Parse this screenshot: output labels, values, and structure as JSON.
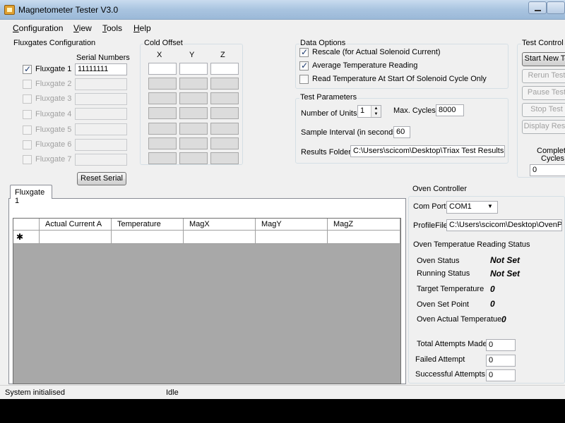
{
  "window": {
    "title": "Magnetometer Tester V3.0"
  },
  "menu": [
    "Configuration",
    "View",
    "Tools",
    "Help"
  ],
  "fluxgates": {
    "group_label": "Fluxgates Configuration",
    "serial_header": "Serial Numbers",
    "rows": [
      {
        "label": "Fluxgate 1",
        "checked": true,
        "enabled": true,
        "serial": "11111111"
      },
      {
        "label": "Fluxgate 2",
        "checked": false,
        "enabled": false,
        "serial": ""
      },
      {
        "label": "Fluxgate 3",
        "checked": false,
        "enabled": false,
        "serial": ""
      },
      {
        "label": "Fluxgate 4",
        "checked": false,
        "enabled": false,
        "serial": ""
      },
      {
        "label": "Fluxgate 5",
        "checked": false,
        "enabled": false,
        "serial": ""
      },
      {
        "label": "Fluxgate 6",
        "checked": false,
        "enabled": false,
        "serial": ""
      },
      {
        "label": "Fluxgate 7",
        "checked": false,
        "enabled": false,
        "serial": ""
      }
    ],
    "reset_button": "Reset Serial"
  },
  "cold_offset": {
    "group_label": "Cold Offset",
    "x": "X",
    "y": "Y",
    "z": "Z"
  },
  "data_options": {
    "group_label": "Data Options",
    "options": [
      {
        "label": "Rescale (for Actual Solenoid Current)",
        "checked": true
      },
      {
        "label": "Average Temperature Reading",
        "checked": true
      },
      {
        "label": "Read Temperature At Start Of Solenoid Cycle Only",
        "checked": false
      }
    ]
  },
  "test_parameters": {
    "group_label": "Test Parameters",
    "units_label": "Number of Units",
    "units_value": "1",
    "max_cycles_label": "Max. Cycles",
    "max_cycles_value": "8000",
    "interval_label": "Sample Interval (in seconds)",
    "interval_value": "60",
    "folder_label": "Results Folder",
    "folder_value": "C:\\Users\\scicom\\Desktop\\Triax Test Results"
  },
  "test_control": {
    "group_label": "Test Control",
    "buttons": [
      "Start New Te",
      "Rerun Test",
      "Pause Test",
      "Stop Test",
      "Display Resu"
    ],
    "completed_label_1": "Complete",
    "completed_label_2": "Cycles",
    "completed_value": "0"
  },
  "tab": {
    "label": "Fluxgate 1"
  },
  "grid": {
    "columns": [
      "Actual Current A",
      "Temperature",
      "MagX",
      "MagY",
      "MagZ"
    ],
    "new_row_marker": "✱"
  },
  "oven": {
    "title": "Oven Controller",
    "com_port_label": "Com Port",
    "com_port_value": "COM1",
    "profile_label": "ProfileFile",
    "profile_value": "C:\\Users\\scicom\\Desktop\\OvenPro",
    "reading_status_title": "Oven Temperatue Reading Status",
    "oven_status_label": "Oven Status",
    "oven_status_value": "Not Set",
    "running_status_label": "Running Status",
    "running_status_value": "Not Set",
    "target_label": "Target Temperature",
    "target_value": "0",
    "setpoint_label": "Oven Set Point",
    "setpoint_value": "0",
    "actual_label": "Oven Actual Temperatue",
    "actual_value": "0",
    "total_attempts_label": "Total Attempts Made",
    "total_attempts_value": "0",
    "failed_label": "Failed Attempt",
    "failed_value": "0",
    "successful_label": "Successful Attempts",
    "successful_value": "0"
  },
  "status": {
    "left": "System initialised",
    "right": "Idle"
  }
}
